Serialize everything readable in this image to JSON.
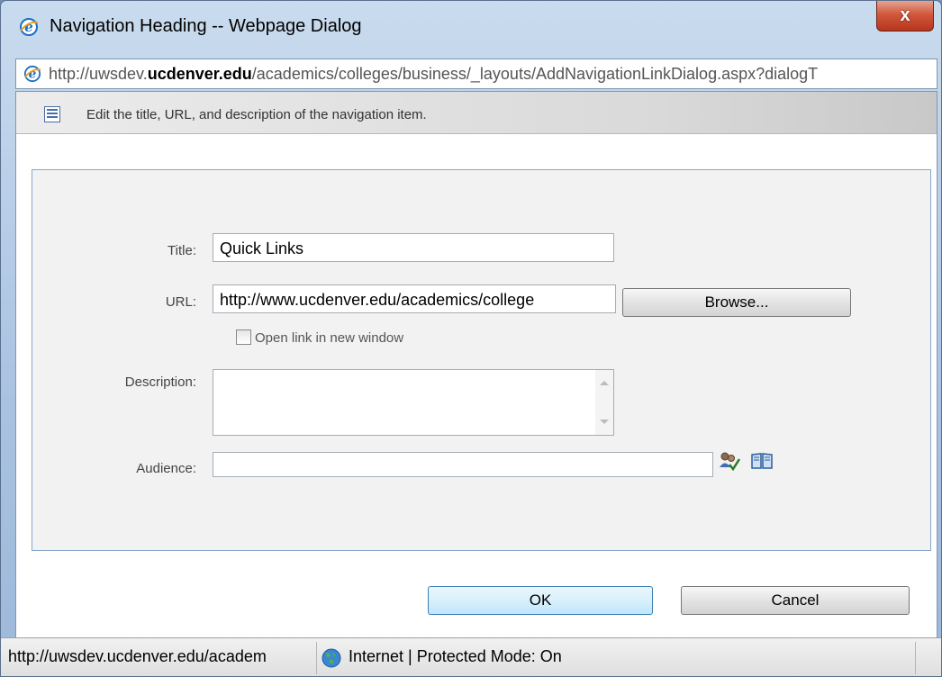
{
  "window": {
    "title": "Navigation Heading -- Webpage Dialog",
    "close_label": "x"
  },
  "address": {
    "prefix": "http://uwsdev.",
    "domain": "ucdenver.edu",
    "path": "/academics/colleges/business/_layouts/AddNavigationLinkDialog.aspx?dialogT"
  },
  "info": {
    "text": "Edit the title, URL, and description of the navigation item."
  },
  "form": {
    "title_label": "Title:",
    "title_value": "Quick Links",
    "url_label": "URL:",
    "url_value": "http://www.ucdenver.edu/academics/college",
    "browse_label": "Browse...",
    "new_window_label": "Open link in new window",
    "new_window_checked": false,
    "description_label": "Description:",
    "description_value": "",
    "audience_label": "Audience:",
    "audience_value": ""
  },
  "buttons": {
    "ok_label": "OK",
    "cancel_label": "Cancel"
  },
  "status": {
    "url": "http://uwsdev.ucdenver.edu/academ",
    "zone": "Internet | Protected Mode: On"
  },
  "icons": {
    "ie": "internet-explorer-icon",
    "info": "list-icon",
    "check_names": "people-check-icon",
    "browse_address_book": "address-book-icon",
    "zone": "globe-icon"
  },
  "colors": {
    "close_button": "#c8482d",
    "ok_button": "#d9f0fc",
    "panel_border": "#88a6c8"
  }
}
